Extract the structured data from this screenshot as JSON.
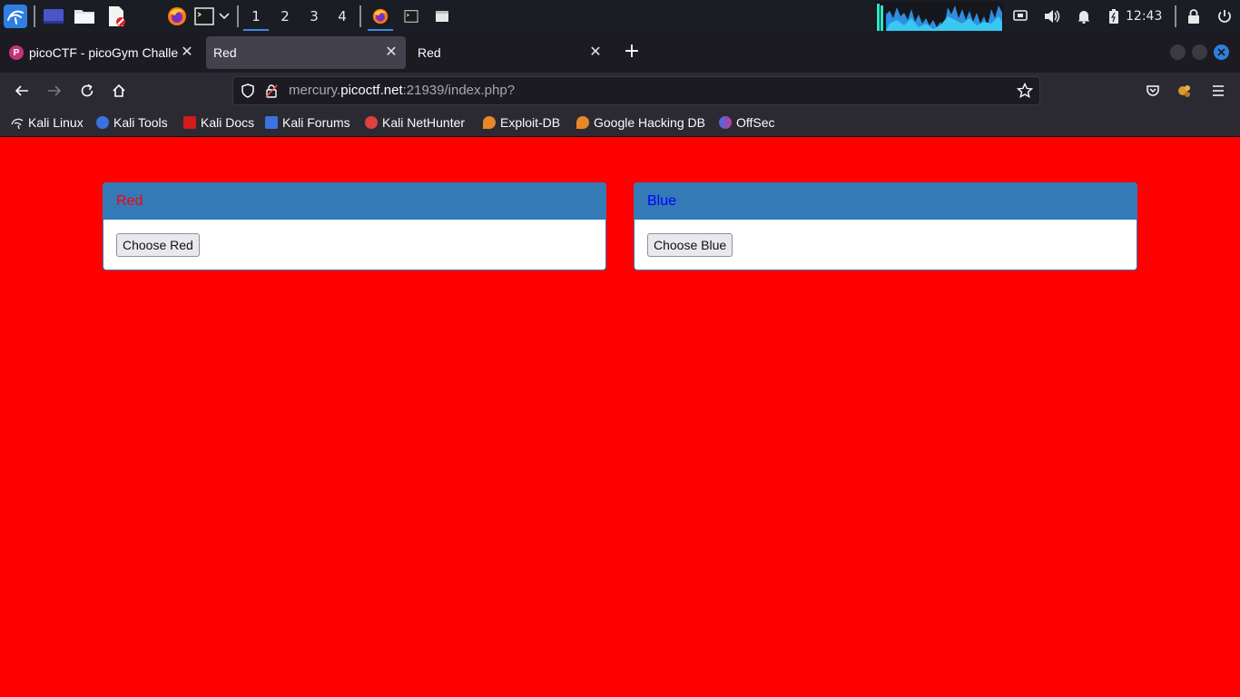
{
  "taskbar": {
    "workspaces": [
      "1",
      "2",
      "3",
      "4"
    ],
    "active_workspace": "1",
    "clock": "12:43",
    "icons": [
      "kali-menu-icon",
      "desktop-icon",
      "file-manager-icon",
      "text-editor-icon",
      "firefox-icon",
      "terminal-icon",
      "chevron-down-icon",
      "firefox-window-icon",
      "terminal-window-icon",
      "window-icon",
      "cpu-graph",
      "display-icon",
      "volume-icon",
      "bell-icon",
      "battery-icon",
      "lock-icon",
      "power-icon"
    ]
  },
  "browser": {
    "tabs": [
      {
        "label": "picoCTF - picoGym Challe",
        "selected": false,
        "icon": "picoctf-favicon"
      },
      {
        "label": "Red",
        "selected": true
      },
      {
        "label": "Red",
        "selected": false
      }
    ],
    "url": {
      "prefix": "mercury.",
      "host": "picoctf.net",
      "suffix": ":21939/index.php?"
    },
    "bookmarks": [
      {
        "label": "Kali Linux",
        "color": "#2f6fd6"
      },
      {
        "label": "Kali Tools",
        "color": "#e23a3a"
      },
      {
        "label": "Kali Docs",
        "color": "#d21b1b"
      },
      {
        "label": "Kali Forums",
        "color": "#3a73e0"
      },
      {
        "label": "Kali NetHunter",
        "color": "#e04040"
      },
      {
        "label": "Exploit-DB",
        "color": "#e8862a"
      },
      {
        "label": "Google Hacking DB",
        "color": "#e8862a"
      },
      {
        "label": "OffSec",
        "color": "#6a5ad8"
      }
    ]
  },
  "page": {
    "background": "#ff0000",
    "cards": [
      {
        "heading": "Red",
        "heading_color": "#ff0000",
        "button": "Choose Red"
      },
      {
        "heading": "Blue",
        "heading_color": "#0000ff",
        "button": "Choose Blue"
      }
    ]
  }
}
